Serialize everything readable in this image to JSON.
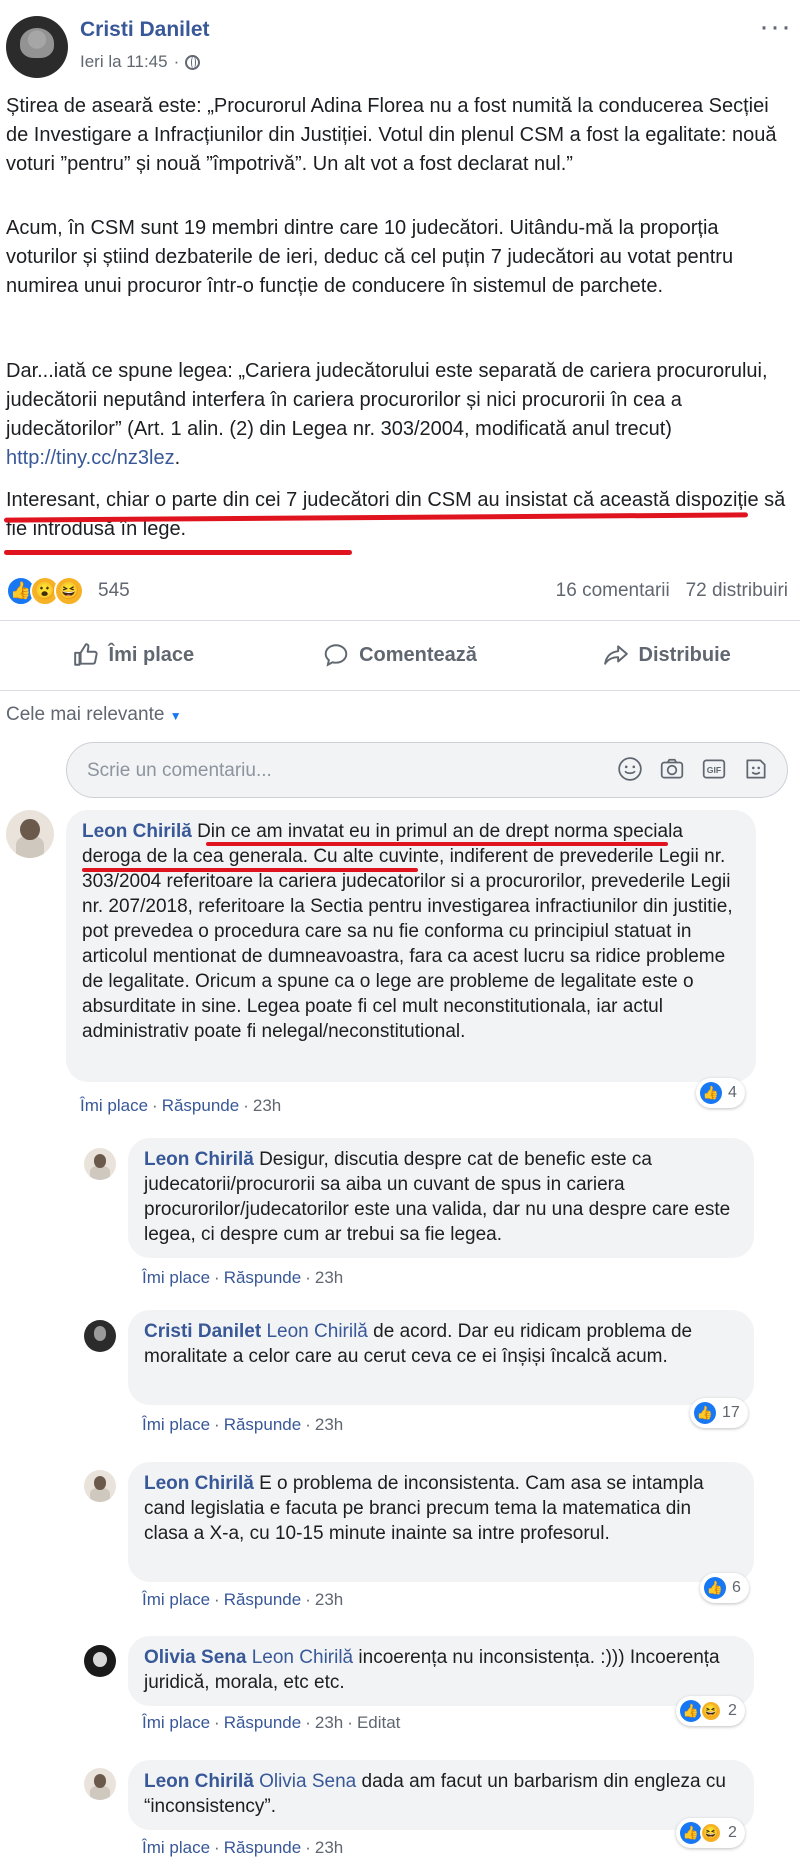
{
  "post": {
    "author": "Cristi Danilet",
    "timestamp": "Ieri la 11:45",
    "more_label": "···",
    "paragraphs": [
      "Știrea de aseară este: „Procurorul Adina Florea nu a fost numită la conducerea Secției de Investigare a Infracțiunilor din Justiției. Votul din plenul CSM a fost la egalitate: nouă voturi ”pentru” și nouă ”împotrivă”. Un alt vot a fost declarat nul.”",
      "Acum, în CSM sunt 19 membri dintre care 10 judecători. Uitându-mă la proporția voturilor și știind dezbaterile de ieri, deduc că cel puțin 7 judecători au votat pentru numirea unui procuror într-o funcție de conducere în sistemul de parchete.",
      "Dar...iată ce spune legea: „Cariera judecătorului este separată de cariera procurorului, judecătorii neputând interfera în cariera procurorilor și nici procurorii în cea a judecătorilor” (Art. 1 alin. (2) din Legea nr. 303/2004, modificată anul trecut)",
      "Interesant, chiar o parte din cei 7 judecători din CSM au insistat că această dispoziție să fie introdusă în lege."
    ],
    "link": "http://tiny.cc/nz3lez",
    "link_suffix": ".",
    "reactions_count": "545",
    "comments_count": "16 comentarii",
    "shares_count": "72 distribuiri"
  },
  "actions": {
    "like": "Îmi place",
    "comment": "Comentează",
    "share": "Distribuie"
  },
  "filter_label": "Cele mai relevante",
  "composer": {
    "placeholder": "Scrie un comentariu..."
  },
  "comment_actions": {
    "like": "Îmi place",
    "reply": "Răspunde",
    "sep": "·",
    "edited": "Editat"
  },
  "comments": [
    {
      "author": "Leon Chirilă",
      "mention": "",
      "text": "Din ce am invatat eu in primul an de drept norma speciala deroga de la cea generala. Cu alte cuvinte, indiferent de prevederile Legii nr. 303/2004 referitoare la cariera judecatorilor si a procurorilor, prevederile Legii nr. 207/2018, referitoare la Sectia pentru investigarea infractiunilor din justitie, pot prevedea o procedura care sa nu fie conforma cu principiul statuat in articolul mentionat de dumneavoastra, fara ca acest lucru sa ridice probleme de legalitate. Oricum a spune ca o lege are probleme de legalitate este o absurditate in sine. Legea poate fi cel mult neconstitutionala, iar actul administrativ poate fi nelegal/neconstitutional.",
      "time": "23h",
      "reactions": "4"
    },
    {
      "author": "Leon Chirilă",
      "mention": "",
      "text": "Desigur, discutia despre cat de benefic este ca judecatorii/procurorii sa aiba un cuvant de spus in cariera procurorilor/judecatorilor este una valida, dar nu una despre care este legea, ci despre cum ar trebui sa fie legea.",
      "time": "23h",
      "reactions": ""
    },
    {
      "author": "Cristi Danilet",
      "mention": "Leon Chirilă",
      "text": "de acord. Dar eu ridicam problema de moralitate a celor care au cerut ceva ce ei înșiși încalcă acum.",
      "time": "23h",
      "reactions": "17"
    },
    {
      "author": "Leon Chirilă",
      "mention": "",
      "text": "E o problema de inconsistenta. Cam asa se intampla cand legislatia e facuta pe branci precum tema la matematica din clasa a X-a, cu 10-15 minute inainte sa intre profesorul.",
      "time": "23h",
      "reactions": "6"
    },
    {
      "author": "Olivia Sena",
      "mention": "Leon Chirilă",
      "text": "incoerența nu inconsistența. :))) Incoerența juridică, morala, etc etc.",
      "time": "23h",
      "reactions": "2"
    },
    {
      "author": "Leon Chirilă",
      "mention": "Olivia Sena",
      "text": "dada am facut un barbarism din engleza cu “inconsistency”.",
      "time": "23h",
      "reactions": "2"
    }
  ],
  "colors": {
    "link": "#385898",
    "annotation": "#e0141e",
    "like_blue": "#1877f2"
  }
}
